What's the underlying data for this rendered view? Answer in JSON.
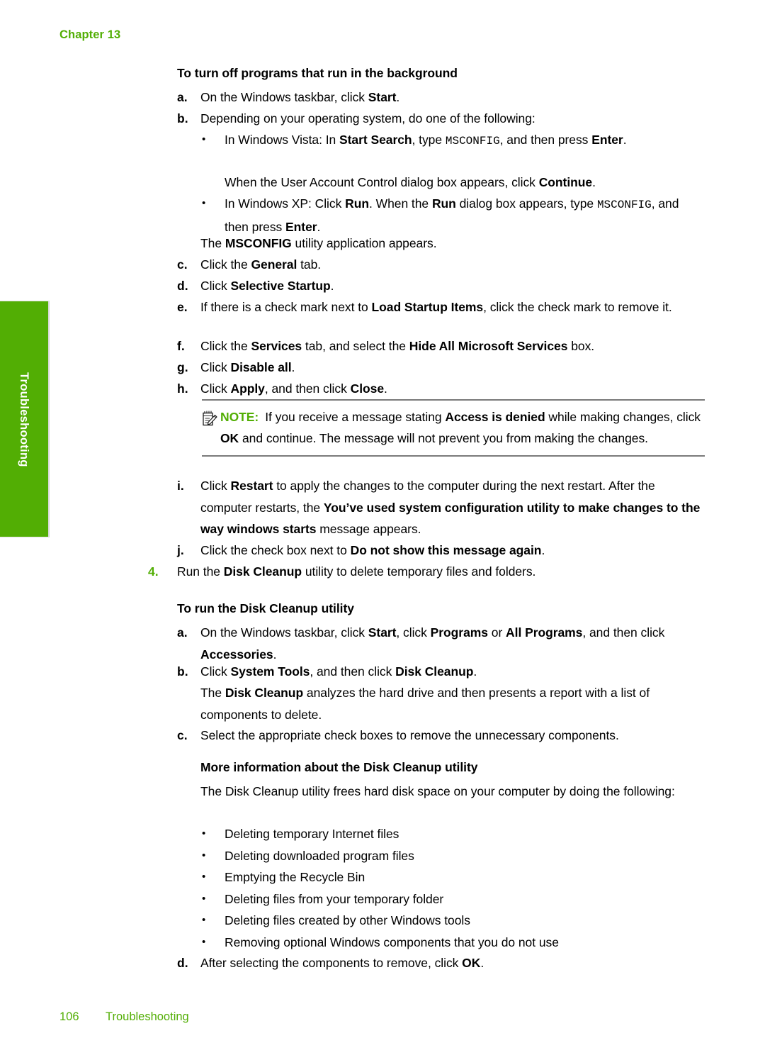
{
  "page": {
    "chapter_label": "Chapter 13",
    "footer_page_number": "106",
    "footer_section": "Troubleshooting",
    "side_tab_label": "Troubleshooting",
    "accent_green": "#52AE04",
    "text_color": "#000000",
    "rule_color": "#7a7a7a"
  },
  "section_bg": {
    "heading": "To turn off programs that run in the background",
    "steps": {
      "a": {
        "marker": "a.",
        "text_parts": [
          {
            "t": "On the Windows taskbar, click ",
            "s": "n"
          },
          {
            "t": "Start",
            "s": "b"
          },
          {
            "t": ".",
            "s": "n"
          }
        ]
      },
      "b": {
        "marker": "b.",
        "text_parts": [
          {
            "t": "Depending on your operating system, do one of the following:",
            "s": "n"
          }
        ]
      },
      "b_bullet1": {
        "marker": "•",
        "text_parts": [
          {
            "t": "In Windows Vista: In ",
            "s": "n"
          },
          {
            "t": "Start Search",
            "s": "b"
          },
          {
            "t": ", type ",
            "s": "n"
          },
          {
            "t": "MSCONFIG",
            "s": "m"
          },
          {
            "t": ", and then press ",
            "s": "n"
          },
          {
            "t": "Enter",
            "s": "b"
          },
          {
            "t": ".",
            "s": "n"
          }
        ]
      },
      "b_bullet1_cont": {
        "text_parts": [
          {
            "t": "When the User Account Control dialog box appears, click ",
            "s": "n"
          },
          {
            "t": "Continue",
            "s": "b"
          },
          {
            "t": ".",
            "s": "n"
          }
        ]
      },
      "b_bullet2": {
        "marker": "•",
        "text_parts": [
          {
            "t": "In Windows XP: Click ",
            "s": "n"
          },
          {
            "t": "Run",
            "s": "b"
          },
          {
            "t": ". When the ",
            "s": "n"
          },
          {
            "t": "Run",
            "s": "b"
          },
          {
            "t": " dialog box appears, type ",
            "s": "n"
          },
          {
            "t": "MSCONFIG",
            "s": "m"
          },
          {
            "t": ", and then press ",
            "s": "n"
          },
          {
            "t": "Enter",
            "s": "b"
          },
          {
            "t": ".",
            "s": "n"
          }
        ]
      },
      "b_result": {
        "text_parts": [
          {
            "t": "The ",
            "s": "n"
          },
          {
            "t": "MSCONFIG",
            "s": "b"
          },
          {
            "t": " utility application appears.",
            "s": "n"
          }
        ]
      },
      "c": {
        "marker": "c.",
        "text_parts": [
          {
            "t": "Click the ",
            "s": "n"
          },
          {
            "t": "General",
            "s": "b"
          },
          {
            "t": " tab.",
            "s": "n"
          }
        ]
      },
      "d": {
        "marker": "d.",
        "text_parts": [
          {
            "t": "Click ",
            "s": "n"
          },
          {
            "t": "Selective Startup",
            "s": "b"
          },
          {
            "t": ".",
            "s": "n"
          }
        ]
      },
      "e": {
        "marker": "e.",
        "text_parts": [
          {
            "t": "If there is a check mark next to ",
            "s": "n"
          },
          {
            "t": "Load Startup Items",
            "s": "b"
          },
          {
            "t": ", click the check mark to remove it.",
            "s": "n"
          }
        ]
      },
      "f": {
        "marker": "f.",
        "text_parts": [
          {
            "t": "Click the ",
            "s": "n"
          },
          {
            "t": "Services",
            "s": "b"
          },
          {
            "t": " tab, and select the ",
            "s": "n"
          },
          {
            "t": "Hide All Microsoft Services",
            "s": "b"
          },
          {
            "t": " box.",
            "s": "n"
          }
        ]
      },
      "g": {
        "marker": "g.",
        "text_parts": [
          {
            "t": "Click ",
            "s": "n"
          },
          {
            "t": "Disable all",
            "s": "b"
          },
          {
            "t": ".",
            "s": "n"
          }
        ]
      },
      "h": {
        "marker": "h.",
        "text_parts": [
          {
            "t": "Click ",
            "s": "n"
          },
          {
            "t": "Apply",
            "s": "b"
          },
          {
            "t": ", and then click ",
            "s": "n"
          },
          {
            "t": "Close",
            "s": "b"
          },
          {
            "t": ".",
            "s": "n"
          }
        ]
      },
      "i": {
        "marker": "i.",
        "text_parts": [
          {
            "t": "Click ",
            "s": "n"
          },
          {
            "t": "Restart",
            "s": "b"
          },
          {
            "t": " to apply the changes to the computer during the next restart. After the computer restarts, the ",
            "s": "n"
          },
          {
            "t": "You’ve used system configuration utility to make changes to the way windows starts",
            "s": "b"
          },
          {
            "t": " message appears.",
            "s": "n"
          }
        ]
      },
      "j": {
        "marker": "j.",
        "text_parts": [
          {
            "t": "Click the check box next to ",
            "s": "n"
          },
          {
            "t": "Do not show this message again",
            "s": "b"
          },
          {
            "t": ".",
            "s": "n"
          }
        ]
      }
    },
    "note": {
      "icon": "note-pencil-icon",
      "label": "NOTE:",
      "text_parts": [
        {
          "t": "If you receive a message stating ",
          "s": "n"
        },
        {
          "t": "Access is denied",
          "s": "b"
        },
        {
          "t": " while making changes, click ",
          "s": "n"
        },
        {
          "t": "OK",
          "s": "b"
        },
        {
          "t": " and continue. The message will not prevent you from making the changes.",
          "s": "n"
        }
      ]
    }
  },
  "step4": {
    "marker": "4.",
    "text_parts": [
      {
        "t": "Run the ",
        "s": "n"
      },
      {
        "t": "Disk Cleanup",
        "s": "b"
      },
      {
        "t": " utility to delete temporary files and folders.",
        "s": "n"
      }
    ]
  },
  "section_dc": {
    "heading": "To run the Disk Cleanup utility",
    "steps": {
      "a": {
        "marker": "a.",
        "text_parts": [
          {
            "t": "On the Windows taskbar, click ",
            "s": "n"
          },
          {
            "t": "Start",
            "s": "b"
          },
          {
            "t": ", click ",
            "s": "n"
          },
          {
            "t": "Programs",
            "s": "b"
          },
          {
            "t": " or ",
            "s": "n"
          },
          {
            "t": "All Programs",
            "s": "b"
          },
          {
            "t": ", and then click ",
            "s": "n"
          },
          {
            "t": "Accessories",
            "s": "b"
          },
          {
            "t": ".",
            "s": "n"
          }
        ]
      },
      "b": {
        "marker": "b.",
        "text_parts": [
          {
            "t": "Click ",
            "s": "n"
          },
          {
            "t": "System Tools",
            "s": "b"
          },
          {
            "t": ", and then click ",
            "s": "n"
          },
          {
            "t": "Disk Cleanup",
            "s": "b"
          },
          {
            "t": ".",
            "s": "n"
          }
        ]
      },
      "b_result": {
        "text_parts": [
          {
            "t": "The ",
            "s": "n"
          },
          {
            "t": "Disk Cleanup",
            "s": "b"
          },
          {
            "t": " analyzes the hard drive and then presents a report with a list of components to delete.",
            "s": "n"
          }
        ]
      },
      "c": {
        "marker": "c.",
        "text_parts": [
          {
            "t": "Select the appropriate check boxes to remove the unnecessary components.",
            "s": "n"
          }
        ]
      },
      "d": {
        "marker": "d.",
        "text_parts": [
          {
            "t": "After selecting the components to remove, click ",
            "s": "n"
          },
          {
            "t": "OK",
            "s": "b"
          },
          {
            "t": ".",
            "s": "n"
          }
        ]
      }
    }
  },
  "section_more": {
    "heading": "More information about the Disk Cleanup utility",
    "intro_parts": [
      {
        "t": "The Disk Cleanup utility frees hard disk space on your computer by doing the following:",
        "s": "n"
      }
    ],
    "bullet_marker": "•",
    "bullets": [
      "Deleting temporary Internet files",
      "Deleting downloaded program files",
      "Emptying the Recycle Bin",
      "Deleting files from your temporary folder",
      "Deleting files created by other Windows tools",
      "Removing optional Windows components that you do not use"
    ]
  }
}
